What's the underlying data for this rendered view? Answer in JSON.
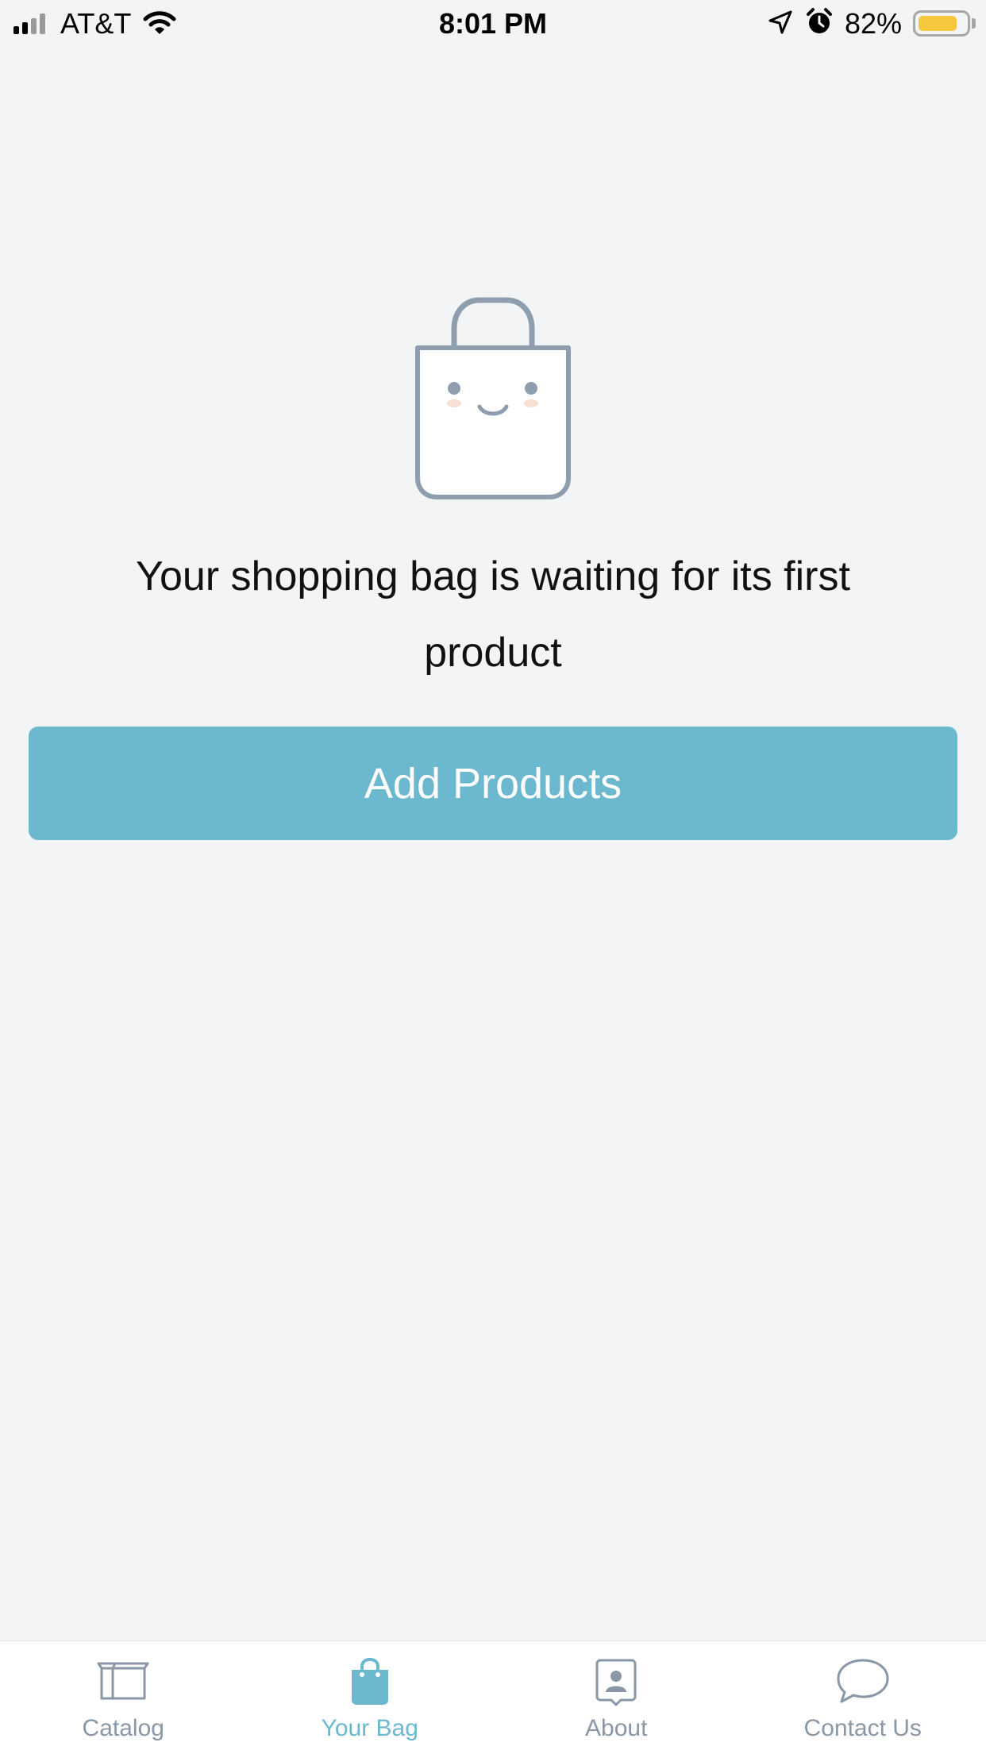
{
  "status_bar": {
    "carrier": "AT&T",
    "time": "8:01 PM",
    "battery_percent": "82%",
    "battery_level": 0.82,
    "icons": [
      "signal-icon",
      "wifi-icon",
      "location-icon",
      "alarm-icon",
      "battery-icon"
    ]
  },
  "empty_state": {
    "illustration": "smiling-shopping-bag-icon",
    "message": "Your shopping bag is waiting for its first product",
    "button_label": "Add Products"
  },
  "tab_bar": {
    "active_index": 1,
    "tabs": [
      {
        "label": "Catalog",
        "icon": "box-icon"
      },
      {
        "label": "Your Bag",
        "icon": "bag-icon"
      },
      {
        "label": "About",
        "icon": "person-card-icon"
      },
      {
        "label": "Contact Us",
        "icon": "chat-bubble-icon"
      }
    ]
  },
  "colors": {
    "background": "#f3f4f6",
    "accent": "#6cb9cf",
    "icon_gray": "#8a97a6",
    "battery": "#f4c73d"
  }
}
